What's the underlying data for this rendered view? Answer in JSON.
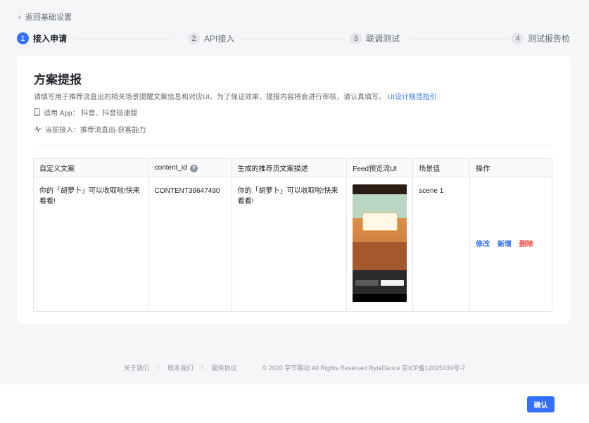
{
  "nav": {
    "back_label": "返回基础设置"
  },
  "steps": [
    {
      "num": "1",
      "label": "接入申请"
    },
    {
      "num": "2",
      "label": "API接入"
    },
    {
      "num": "3",
      "label": "联调测试"
    },
    {
      "num": "4",
      "label": "测试报告检"
    }
  ],
  "card": {
    "title": "方案提报",
    "description": "请填写用于推荐流直出的相关场景提醒文案信息和对应UI。为了保证效果，提报内容将会进行审核，请认真填写。",
    "guide_link": "UI设计规范指引",
    "app_line": "适用 App： 抖音、抖音极速版",
    "access_line": "当前接入：推荐流直出-获客能力"
  },
  "table": {
    "headers": [
      "自定义文案",
      "content_id",
      "生成的推荐页文案描述",
      "Feed预览流UI",
      "场景值",
      "操作"
    ],
    "row": {
      "custom_text": "你的「胡萝卜」可以收取啦!快来看看!",
      "content_id": "CONTENT39647490",
      "generated_desc": "你的「胡萝卜」可以收取啦!快来看看!",
      "scene": "scene 1",
      "ops": {
        "edit": "修改",
        "add": "新增",
        "delete": "删除"
      }
    }
  },
  "footer": {
    "about": "关于我们",
    "contact": "联系我们",
    "terms": "服务协议",
    "copyright": "© 2020 字节跳动 All Rights Reserved ByteDance 京ICP备12025439号-7"
  },
  "actions": {
    "confirm": "确认"
  },
  "colors": {
    "accent": "#3370ff",
    "danger": "#f54a45"
  },
  "icons": {
    "back": "chevron-left-icon",
    "help": "question-circle-icon",
    "app": "phone-icon",
    "access": "activity-icon"
  }
}
